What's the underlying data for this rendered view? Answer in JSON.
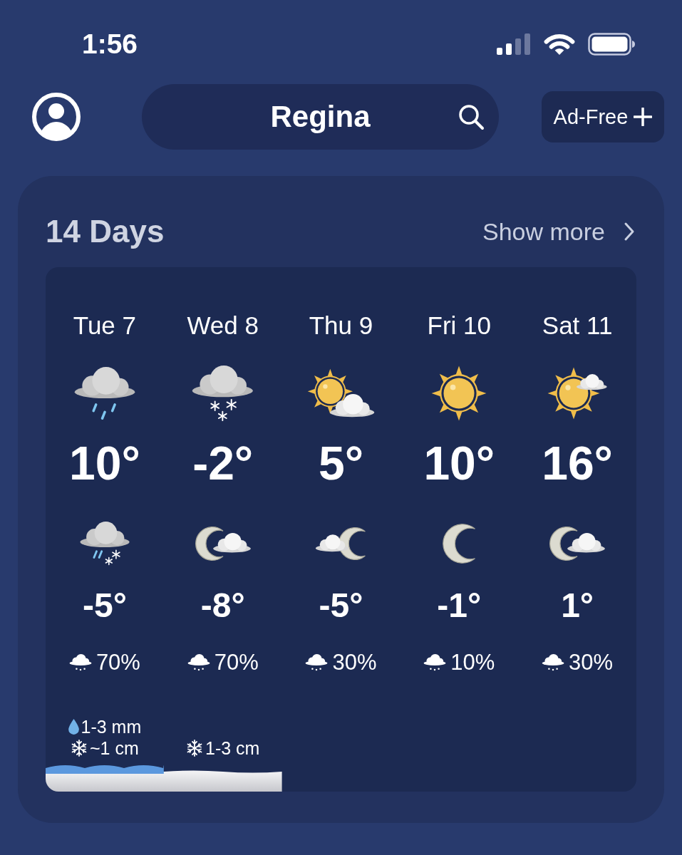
{
  "status_bar": {
    "time": "1:56"
  },
  "header": {
    "location": "Regina",
    "ad_free_button": "Ad-Free"
  },
  "forecast": {
    "title": "14 Days",
    "show_more": "Show more",
    "days": [
      {
        "label": "Tue 7",
        "day_icon": {
          "kind": "rain"
        },
        "high": "10°",
        "night_icon": {
          "kind": "sleet"
        },
        "low": "-5°",
        "precipitation": "70%",
        "rain_amount": "1-3 mm",
        "snow_amount": "~1 cm"
      },
      {
        "label": "Wed 8",
        "day_icon": {
          "kind": "snow"
        },
        "high": "-2°",
        "night_icon": {
          "kind": "mostlyclear"
        },
        "low": "-8°",
        "precipitation": "70%",
        "snow_amount": "1-3 cm"
      },
      {
        "label": "Thu 9",
        "day_icon": {
          "kind": "partlycloudy"
        },
        "high": "5°",
        "night_icon": {
          "kind": "partlycloudy"
        },
        "low": "-5°",
        "precipitation": "30%"
      },
      {
        "label": "Fri 10",
        "day_icon": {
          "kind": "sunny"
        },
        "high": "10°",
        "night_icon": {
          "kind": "clear"
        },
        "low": "-1°",
        "precipitation": "10%"
      },
      {
        "label": "Sat 11",
        "day_icon": {
          "kind": "mostlysunny"
        },
        "high": "16°",
        "night_icon": {
          "kind": "mostlyclear"
        },
        "low": "1°",
        "precipitation": "30%"
      }
    ]
  }
}
